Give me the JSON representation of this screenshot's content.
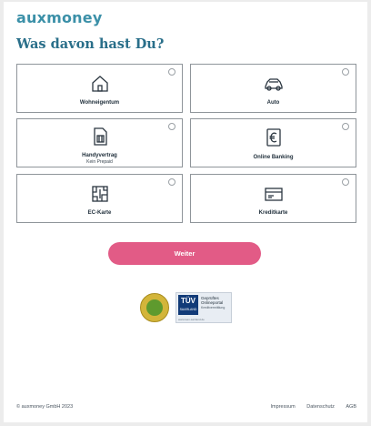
{
  "brand": {
    "logo_text": "auxmoney"
  },
  "page": {
    "headline": "Was davon hast Du?"
  },
  "options": [
    {
      "label": "Wohneigentum",
      "sub": "",
      "icon": "house-icon"
    },
    {
      "label": "Auto",
      "sub": "",
      "icon": "car-icon"
    },
    {
      "label": "Handyvertrag",
      "sub": "Kein Prepaid",
      "icon": "sim-card-icon"
    },
    {
      "label": "Online Banking",
      "sub": "",
      "icon": "euro-device-icon"
    },
    {
      "label": "EC-Karte",
      "sub": "",
      "icon": "chip-card-icon"
    },
    {
      "label": "Kreditkarte",
      "sub": "",
      "icon": "credit-card-icon"
    }
  ],
  "cta": {
    "label": "Weiter",
    "color": "#e25b86"
  },
  "trust": {
    "tuv_mark": "TÜV",
    "tuv_region": "SAARLAND",
    "tuv_title": "Geprüftes Onlineportal",
    "tuv_sub": "Kreditvermittlung",
    "tuv_code": "www.tuev-sarrland.de"
  },
  "footer": {
    "copyright": "© auxmoney GmbH 2023",
    "links": [
      "Impressum",
      "Datenschutz",
      "AGB"
    ]
  },
  "colors": {
    "brand": "#3b90a8",
    "headline": "#2a6f8a",
    "accent": "#e25b86"
  }
}
